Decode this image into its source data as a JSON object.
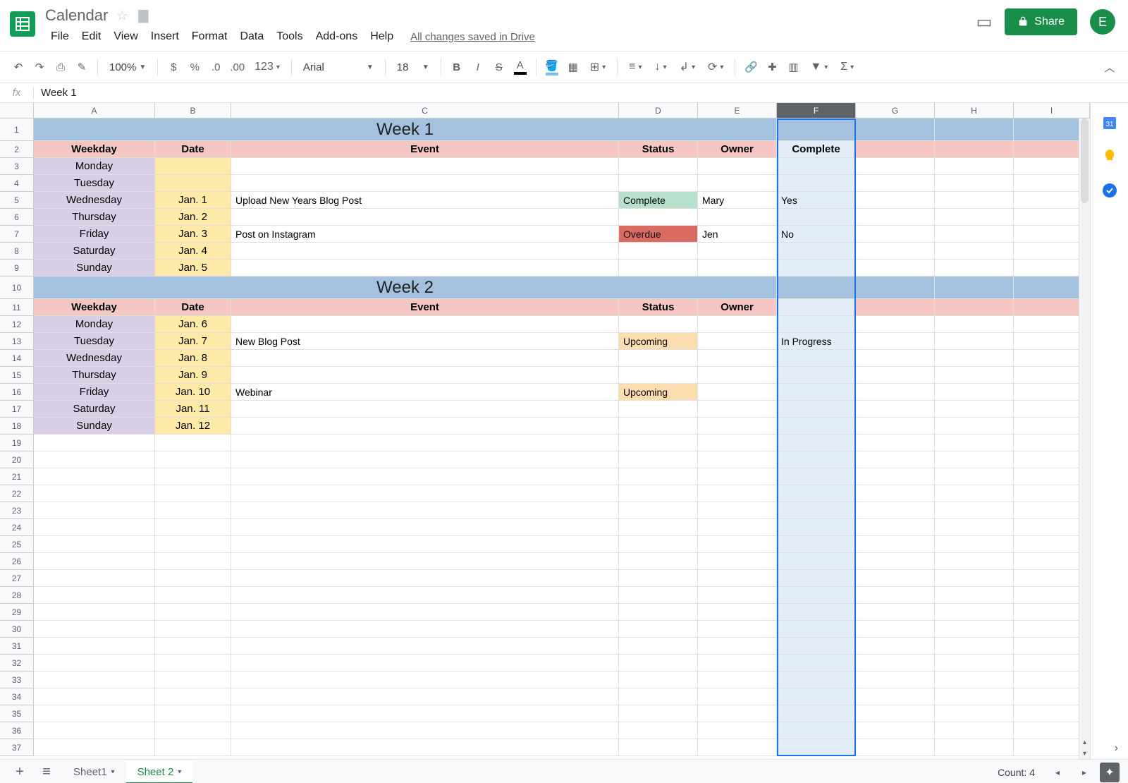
{
  "doc": {
    "title": "Calendar",
    "drive_status": "All changes saved in Drive"
  },
  "menus": [
    "File",
    "Edit",
    "View",
    "Insert",
    "Format",
    "Data",
    "Tools",
    "Add-ons",
    "Help"
  ],
  "share": {
    "label": "Share"
  },
  "avatar": {
    "initial": "E"
  },
  "toolbar": {
    "zoom": "100%",
    "font": "Arial",
    "font_size": "18",
    "num_format": "123"
  },
  "formula": {
    "value": "Week 1"
  },
  "columns": [
    "A",
    "B",
    "C",
    "D",
    "E",
    "F",
    "G",
    "H",
    "I"
  ],
  "selected_column": "F",
  "row_count": 37,
  "week1": {
    "title": "Week 1",
    "headers": [
      "Weekday",
      "Date",
      "Event",
      "Status",
      "Owner",
      "Complete"
    ],
    "rows": [
      {
        "weekday": "Monday",
        "date": "",
        "event": "",
        "status": "",
        "owner": "",
        "complete": ""
      },
      {
        "weekday": "Tuesday",
        "date": "",
        "event": "",
        "status": "",
        "owner": "",
        "complete": ""
      },
      {
        "weekday": "Wednesday",
        "date": "Jan. 1",
        "event": "Upload New Years Blog Post",
        "status": "Complete",
        "status_class": "complete",
        "owner": "Mary",
        "complete": "Yes"
      },
      {
        "weekday": "Thursday",
        "date": "Jan. 2",
        "event": "",
        "status": "",
        "owner": "",
        "complete": ""
      },
      {
        "weekday": "Friday",
        "date": "Jan. 3",
        "event": "Post on Instagram",
        "status": "Overdue",
        "status_class": "overdue",
        "owner": "Jen",
        "complete": "No"
      },
      {
        "weekday": "Saturday",
        "date": "Jan. 4",
        "event": "",
        "status": "",
        "owner": "",
        "complete": ""
      },
      {
        "weekday": "Sunday",
        "date": "Jan. 5",
        "event": "",
        "status": "",
        "owner": "",
        "complete": ""
      }
    ]
  },
  "week2": {
    "title": "Week 2",
    "headers": [
      "Weekday",
      "Date",
      "Event",
      "Status",
      "Owner",
      ""
    ],
    "rows": [
      {
        "weekday": "Monday",
        "date": "Jan. 6",
        "event": "",
        "status": "",
        "owner": "",
        "complete": ""
      },
      {
        "weekday": "Tuesday",
        "date": "Jan. 7",
        "event": "New Blog Post",
        "status": "Upcoming",
        "status_class": "upcoming",
        "owner": "",
        "complete": "In Progress"
      },
      {
        "weekday": "Wednesday",
        "date": "Jan. 8",
        "event": "",
        "status": "",
        "owner": "",
        "complete": ""
      },
      {
        "weekday": "Thursday",
        "date": "Jan. 9",
        "event": "",
        "status": "",
        "owner": "",
        "complete": ""
      },
      {
        "weekday": "Friday",
        "date": "Jan. 10",
        "event": "Webinar",
        "status": "Upcoming",
        "status_class": "upcoming",
        "owner": "",
        "complete": ""
      },
      {
        "weekday": "Saturday",
        "date": "Jan. 11",
        "event": "",
        "status": "",
        "owner": "",
        "complete": ""
      },
      {
        "weekday": "Sunday",
        "date": "Jan. 12",
        "event": "",
        "status": "",
        "owner": "",
        "complete": ""
      }
    ]
  },
  "sheets": {
    "tabs": [
      "Sheet1",
      "Sheet 2"
    ],
    "active": 1
  },
  "footer": {
    "count": "Count: 4"
  }
}
